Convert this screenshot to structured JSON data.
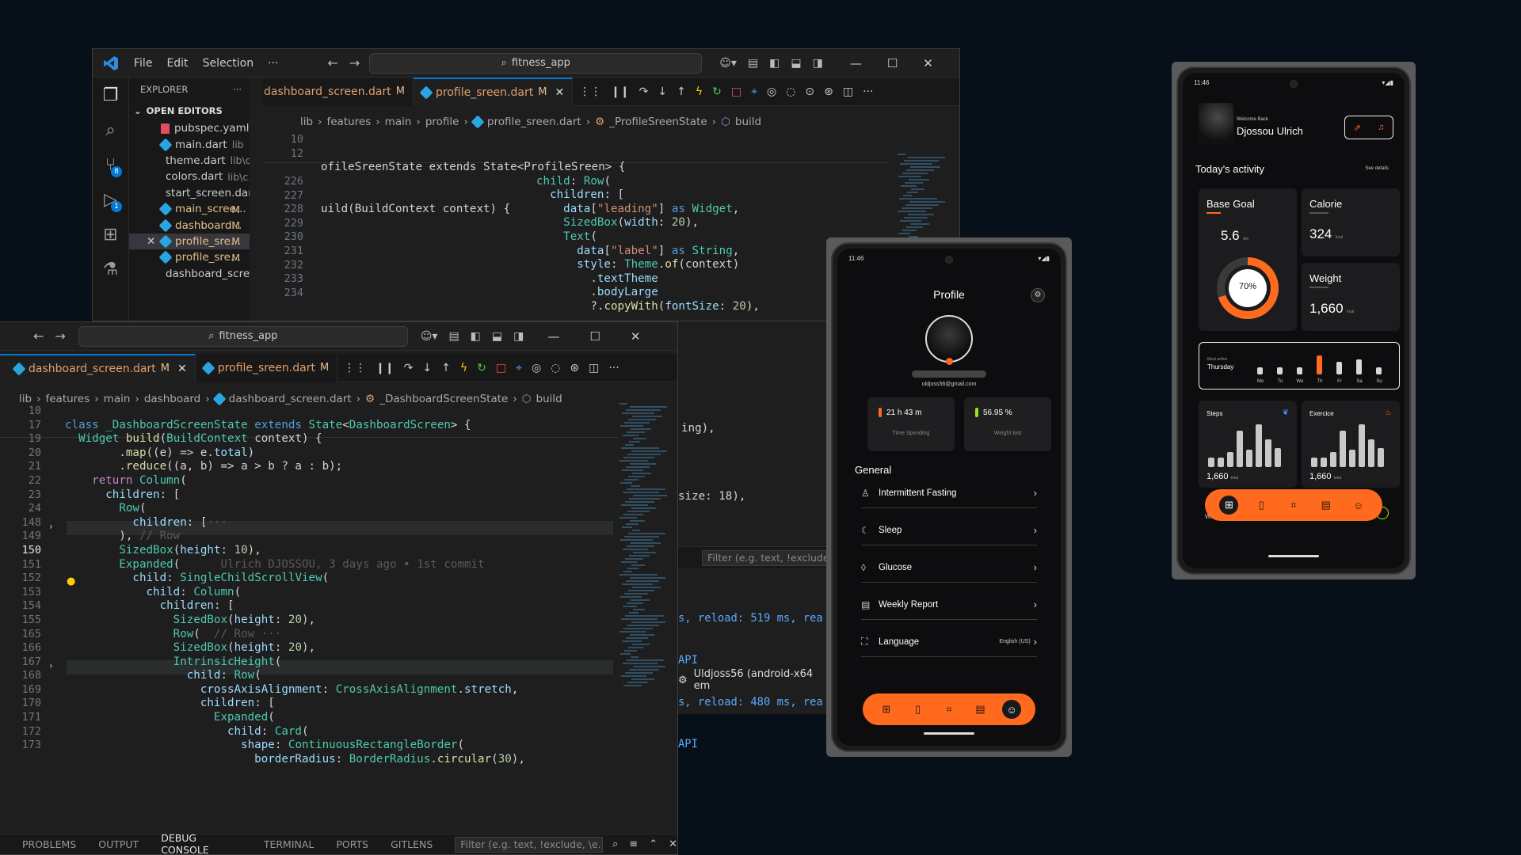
{
  "back_window": {
    "menu": [
      "File",
      "Edit",
      "Selection",
      "···"
    ],
    "search": "fitness_app",
    "explorer_title": "EXPLORER",
    "open_editors_label": "OPEN EDITORS",
    "open_editors": [
      {
        "name": "pubspec.yaml",
        "path": "",
        "mark": "",
        "type": "yaml"
      },
      {
        "name": "main.dart",
        "path": "lib",
        "mark": "",
        "type": "dart"
      },
      {
        "name": "theme.dart",
        "path": "lib\\c...",
        "mark": "",
        "type": "dart"
      },
      {
        "name": "colors.dart",
        "path": "lib\\c...",
        "mark": "",
        "type": "dart"
      },
      {
        "name": "start_screen.dart...",
        "path": "",
        "mark": "",
        "type": "dart"
      },
      {
        "name": "main_scree...",
        "path": "",
        "mark": "M",
        "type": "dart"
      },
      {
        "name": "dashboard...",
        "path": "",
        "mark": "M",
        "type": "dart"
      },
      {
        "name": "profile_sre...",
        "path": "",
        "mark": "M",
        "type": "dart"
      },
      {
        "name": "profile_sre...",
        "path": "",
        "mark": "M",
        "type": "dart"
      },
      {
        "name": "dashboard_scre...",
        "path": "",
        "mark": "",
        "type": "dart"
      }
    ],
    "badges": {
      "source_control": "8",
      "debug": "1"
    },
    "tabs": [
      {
        "label": "dashboard_screen.dart",
        "mark": "M"
      },
      {
        "label": "profile_sreen.dart",
        "mark": "M"
      }
    ],
    "breadcrumb": [
      "lib",
      "features",
      "main",
      "profile",
      "profile_sreen.dart",
      "_ProfileSreenState",
      "build"
    ],
    "sticky": [
      {
        "n": "10",
        "code": "ofileSreenState extends State<ProfileSreen> {"
      },
      {
        "n": "12",
        "code": "uild(BuildContext context) {"
      }
    ],
    "line_numbers": [
      "226",
      "227",
      "228",
      "229",
      "230",
      "231",
      "232",
      "233",
      "234"
    ],
    "code_right_fragments": [
      "ing),",
      "size: 18),"
    ],
    "filter_placeholder": "Filter (e.g. text, !exclude, \\e",
    "console_lines": [
      "s, reload: 519 ms, rea",
      "API",
      "s, reload: 480 ms, rea",
      "API"
    ],
    "device_label": "Uldjoss56 (android-x64 em"
  },
  "front_window": {
    "search": "fitness_app",
    "tabs": [
      {
        "label": "dashboard_screen.dart",
        "mark": "M"
      },
      {
        "label": "profile_sreen.dart",
        "mark": "M"
      }
    ],
    "breadcrumb": [
      "lib",
      "features",
      "main",
      "dashboard",
      "dashboard_screen.dart",
      "_DashboardScreenState",
      "build"
    ],
    "line_numbers": [
      "10",
      "17",
      "19",
      "20",
      "21",
      "22",
      "23",
      "24",
      "148",
      "149",
      "150",
      "151",
      "152",
      "153",
      "154",
      "155",
      "165",
      "166",
      "167",
      "168",
      "169",
      "170",
      "171",
      "172",
      "173"
    ],
    "current_line": "150",
    "blame": "Ulrich DJOSSOU, 3 days ago • 1st commit",
    "panel_tabs": [
      "PROBLEMS",
      "OUTPUT",
      "DEBUG CONSOLE",
      "TERMINAL",
      "PORTS",
      "GITLENS"
    ],
    "active_panel_tab": "DEBUG CONSOLE",
    "panel_filter": "Filter (e.g. text, !exclude, \\e..."
  },
  "profile_phone": {
    "time": "11:46",
    "title": "Profile",
    "email": "uldjoss56@gmail.com",
    "stats": [
      {
        "value": "21 h 43 m",
        "label": "Time Spending",
        "color": "#ff6a1f"
      },
      {
        "value": "56.95 %",
        "label": "Weight lost",
        "color": "#9be21b"
      }
    ],
    "section": "General",
    "items": [
      {
        "label": "Intermittent Fasting",
        "extra": "",
        "icon": "person-icon"
      },
      {
        "label": "Sleep",
        "extra": "",
        "icon": "moon-icon"
      },
      {
        "label": "Glucose",
        "extra": "",
        "icon": "drop-icon"
      },
      {
        "label": "Weekly Report",
        "extra": "",
        "icon": "report-icon"
      },
      {
        "label": "Language",
        "extra": "English (US)",
        "icon": "translate-icon"
      }
    ]
  },
  "dashboard_phone": {
    "time": "11:46",
    "welcome": "Welcome Back",
    "name": "Djossou Ulrich",
    "today": "Today's activity",
    "see_details": "See details",
    "base_goal": {
      "title": "Base Goal",
      "value": "5.6",
      "unit": "km",
      "percent": "70%",
      "progress": 0.7
    },
    "calorie": {
      "title": "Calorie",
      "value": "324",
      "unit": "kcal"
    },
    "weight": {
      "title": "Weight",
      "value": "1,660",
      "unit": "kcal"
    },
    "most_active_label": "Most active",
    "most_active_day": "Thursday",
    "days": [
      {
        "d": "Mo",
        "level": 0.25
      },
      {
        "d": "Tu",
        "level": 0.25
      },
      {
        "d": "We",
        "level": 0.25
      },
      {
        "d": "Th",
        "level": 1.0
      },
      {
        "d": "Fr",
        "level": 0.6
      },
      {
        "d": "Sa",
        "level": 0.75
      },
      {
        "d": "Su",
        "level": 0.25
      }
    ],
    "steps": {
      "title": "Steps",
      "value": "1,660",
      "unit": "total"
    },
    "exercise": {
      "title": "Exercice",
      "value": "1,660",
      "unit": "total"
    },
    "weight_bottom": "Weig",
    "accent": "#ff6a1f"
  }
}
